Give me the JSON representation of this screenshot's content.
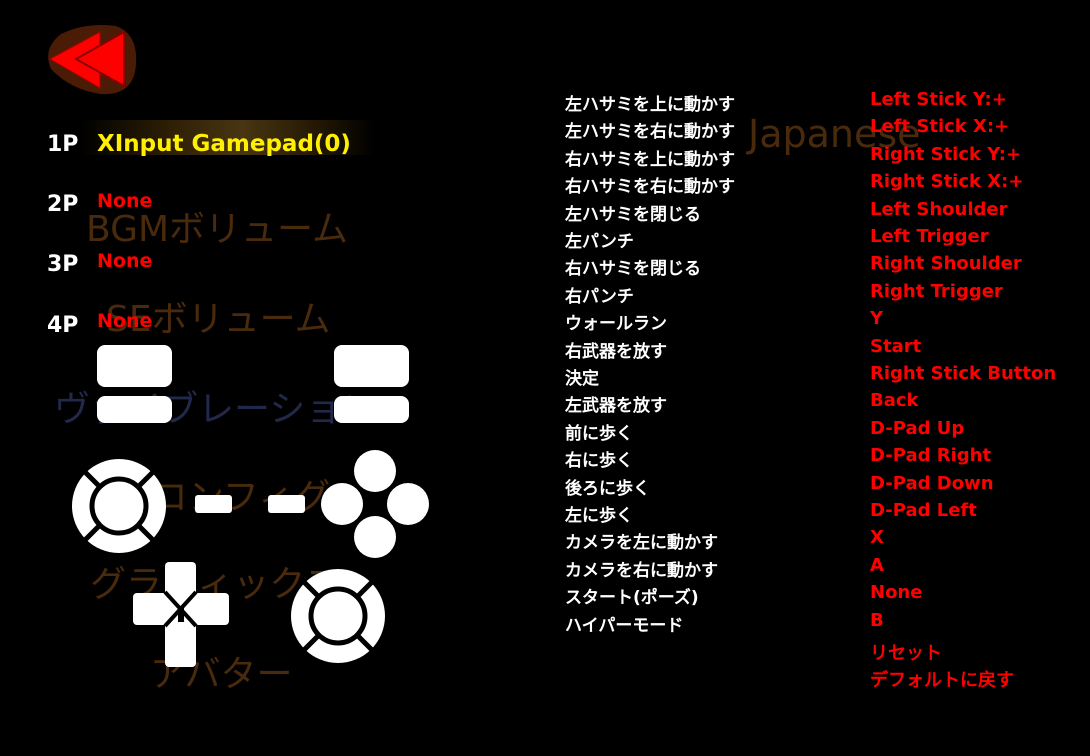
{
  "background_menu": {
    "language": "Japanese",
    "bgm": "BGMボリューム",
    "se": "SEボリューム",
    "vibration": "ヴァイブレーション",
    "keyconfig": "キーコンフィグ",
    "graphics": "グラフィックス",
    "avatar": "アバター"
  },
  "back_icon": "double-left-arrow-icon",
  "players": [
    {
      "label": "1P",
      "device": "XInput Gamepad(0)"
    },
    {
      "label": "2P",
      "device": "None"
    },
    {
      "label": "3P",
      "device": "None"
    },
    {
      "label": "4P",
      "device": "None"
    }
  ],
  "bindings": [
    {
      "action": "左ハサミを上に動かす",
      "key": "Left Stick Y:+"
    },
    {
      "action": "左ハサミを右に動かす",
      "key": "Left Stick X:+"
    },
    {
      "action": "右ハサミを上に動かす",
      "key": "Right Stick Y:+"
    },
    {
      "action": "右ハサミを右に動かす",
      "key": "Right Stick X:+"
    },
    {
      "action": "左ハサミを閉じる",
      "key": "Left Shoulder"
    },
    {
      "action": "左パンチ",
      "key": "Left Trigger"
    },
    {
      "action": "右ハサミを閉じる",
      "key": "Right Shoulder"
    },
    {
      "action": "右パンチ",
      "key": "Right Trigger"
    },
    {
      "action": "ウォールラン",
      "key": "Y"
    },
    {
      "action": "右武器を放す",
      "key": "Start"
    },
    {
      "action": "決定",
      "key": "Right Stick Button"
    },
    {
      "action": "左武器を放す",
      "key": "Back"
    },
    {
      "action": "前に歩く",
      "key": "D-Pad Up"
    },
    {
      "action": "右に歩く",
      "key": "D-Pad Right"
    },
    {
      "action": "後ろに歩く",
      "key": "D-Pad Down"
    },
    {
      "action": "左に歩く",
      "key": "D-Pad Left"
    },
    {
      "action": "カメラを左に動かす",
      "key": "X"
    },
    {
      "action": "カメラを右に動かす",
      "key": "A"
    },
    {
      "action": "スタート(ポーズ)",
      "key": "None"
    },
    {
      "action": "ハイパーモード",
      "key": "B"
    }
  ],
  "reset_label": "リセット",
  "default_label": "デフォルトに戻す",
  "colors": {
    "selected": "#ffef00",
    "value": "#ff0000",
    "label": "#ffffff",
    "background": "#000000"
  }
}
